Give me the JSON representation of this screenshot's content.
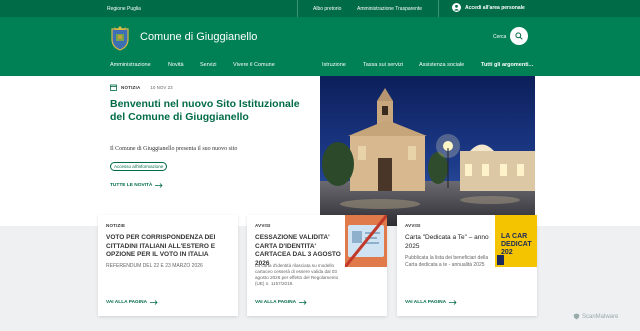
{
  "topbar": {
    "region": "Regione Puglia",
    "albo": "Albo pretorio",
    "amministrazione_trasparente": "Amministrazione Trasparente",
    "login": "Accedi all'area personale"
  },
  "header": {
    "title": "Comune di Giuggianello",
    "search_label": "Cerca"
  },
  "nav": {
    "primary": [
      "Amministrazione",
      "Novità",
      "Servizi",
      "Vivere il Comune"
    ],
    "secondary": [
      "Istruzione",
      "Tassa sui servizi",
      "Assistenza sociale"
    ],
    "all_topics": "Tutti gli argomenti..."
  },
  "hero": {
    "tag": "NOTIZIA",
    "date": "10 NOV 23",
    "title": "Benvenuti nel nuovo Sito Istituzionale del Comune di Giuggianello",
    "subtitle": "Il Comune di Giuggianello presenta il suo nuovo sito",
    "chip": "Accesso all'informazione",
    "all_news": "TUTTE LE NOVITÀ"
  },
  "cards": [
    {
      "category": "NOTIZIE",
      "title": "VOTO PER CORRISPONDENZA DEI CITTADINI ITALIANI ALL'ESTERO E OPZIONE PER IL VOTO IN ITALIA",
      "text": "REFERENDUM DEL 22 E 23 MARZO 2026",
      "more": "VAI ALLA PAGINA"
    },
    {
      "category": "AVVISI",
      "title": "CESSAZIONE VALIDITA' CARTA D'IDENTITA' CARTACEA DAL 3 AGOSTO 2026",
      "text": "La carta d'identità rilasciata su modello cartaceo cesserà di essere valida dal 03 agosto 2026 per effetto del Regolamento (UE) n. 1157/2019.",
      "more": "VAI ALLA PAGINA"
    },
    {
      "category": "AVVISI",
      "title": "Carta \"Dedicata a Te\" – anno 2025",
      "text": "Pubblicata la lista dei beneficiari della Carta dedicata a te - annualità 2025",
      "more": "VAI ALLA PAGINA",
      "thumb_text": "LA CAR DEDICAT 202"
    }
  ],
  "watermark": "ScanMalware",
  "colors": {
    "primary": "#008055",
    "dark": "#006b47",
    "yellow": "#f5c400"
  }
}
